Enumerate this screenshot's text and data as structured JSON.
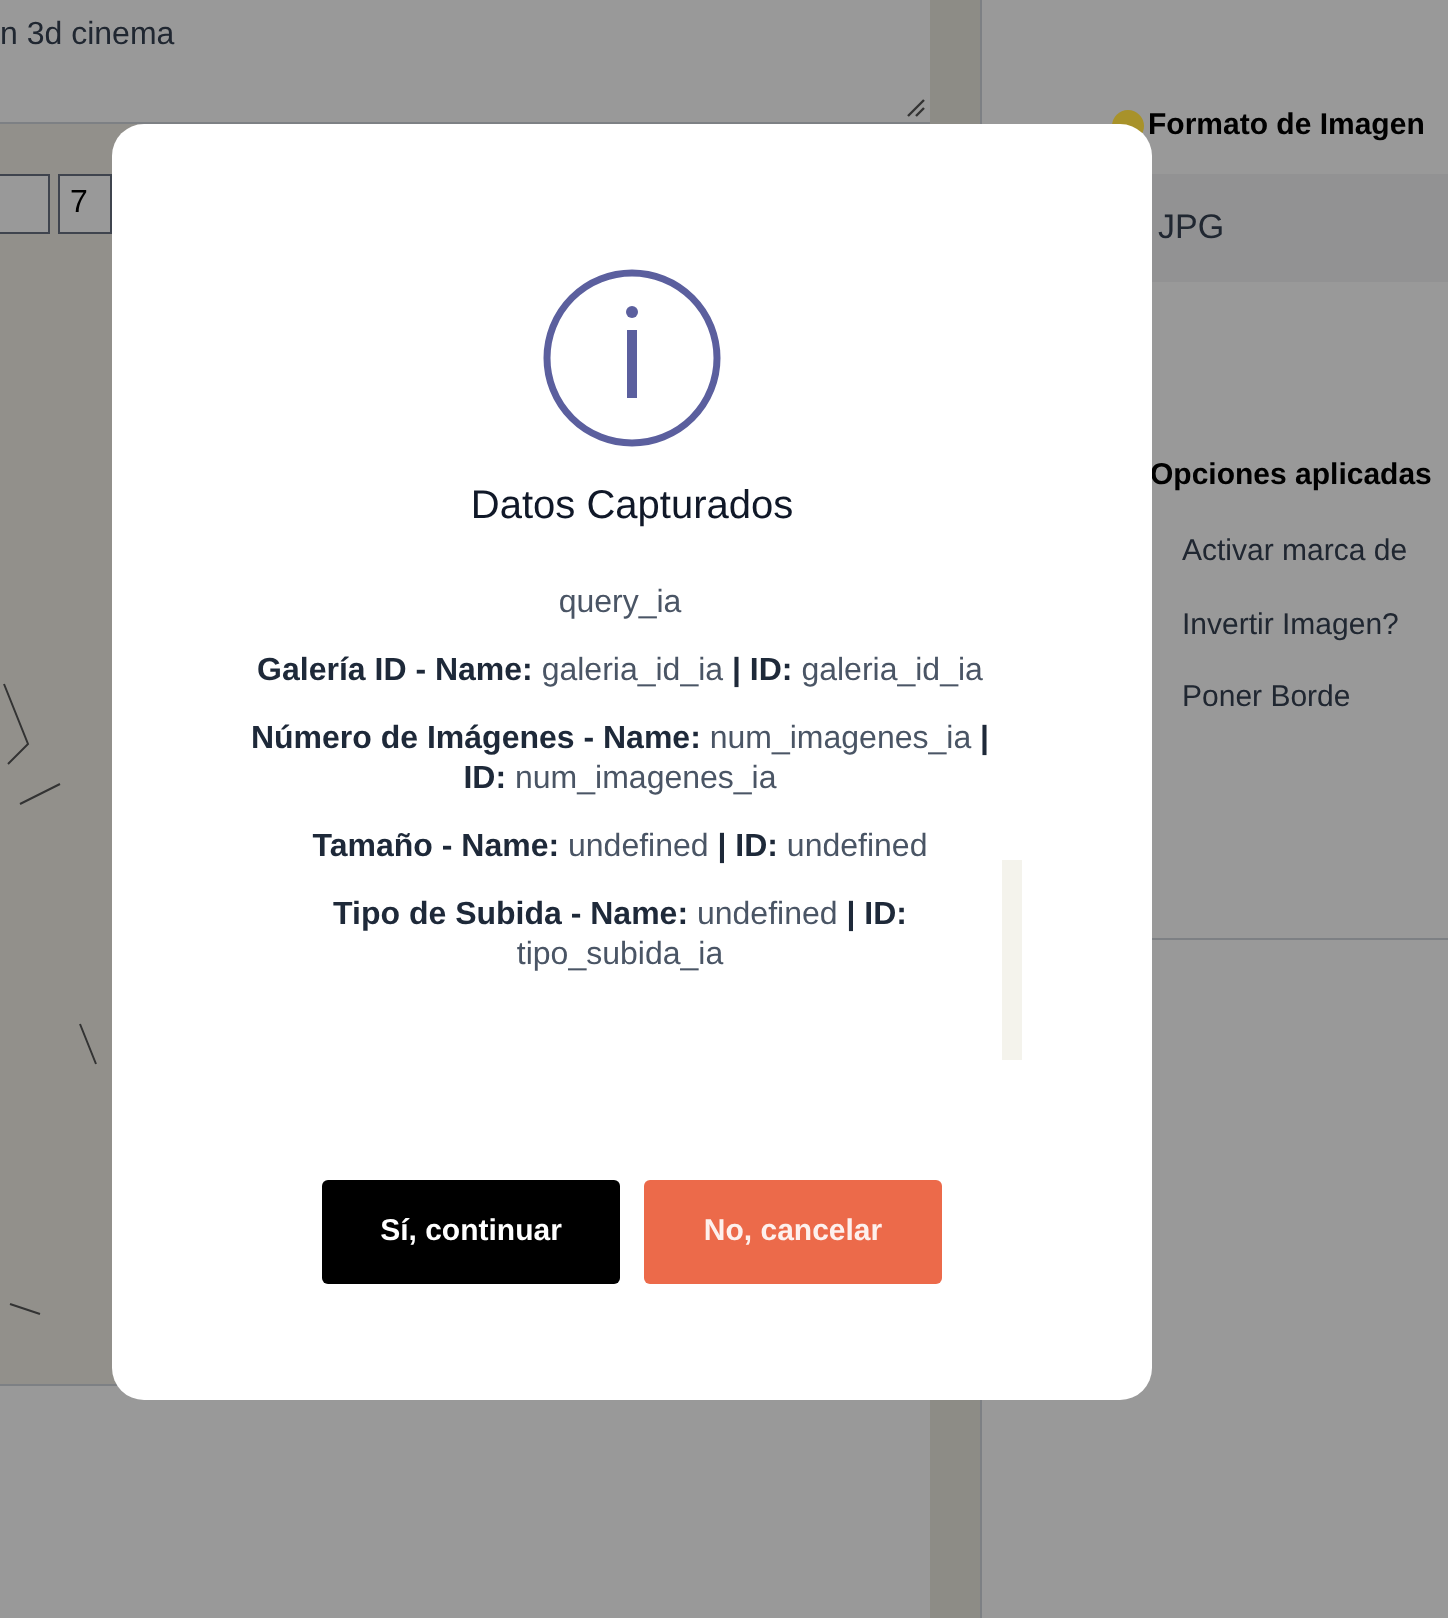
{
  "background": {
    "prompt_text": "n 3d cinema",
    "number_fields": [
      {
        "value": "7"
      }
    ],
    "format": {
      "label": "Formato de Imagen",
      "color": "#a8922a",
      "value": "JPG"
    },
    "options": {
      "title": "Opciones aplicadas",
      "items": [
        {
          "label": "Activar marca de"
        },
        {
          "label": "Invertir Imagen?"
        },
        {
          "label": "Poner Borde"
        }
      ]
    }
  },
  "dialog": {
    "title": "Datos Capturados",
    "lines": [
      "query_ia",
      "**Galería ID - Name:** galeria_id_ia **| ID:** galeria_id_ia",
      "**Número de Imágenes - Name:** num_imagenes_ia **| ID:** num_imagenes_ia",
      "**Tamaño - Name:** undefined **| ID:** undefined",
      "**Tipo de Subida - Name:** undefined **| ID:** tipo_subida_ia"
    ],
    "buttons": [
      {
        "label": "Sí, continuar",
        "kind": "confirm"
      },
      {
        "label": "No, cancelar",
        "kind": "cancel"
      }
    ]
  }
}
